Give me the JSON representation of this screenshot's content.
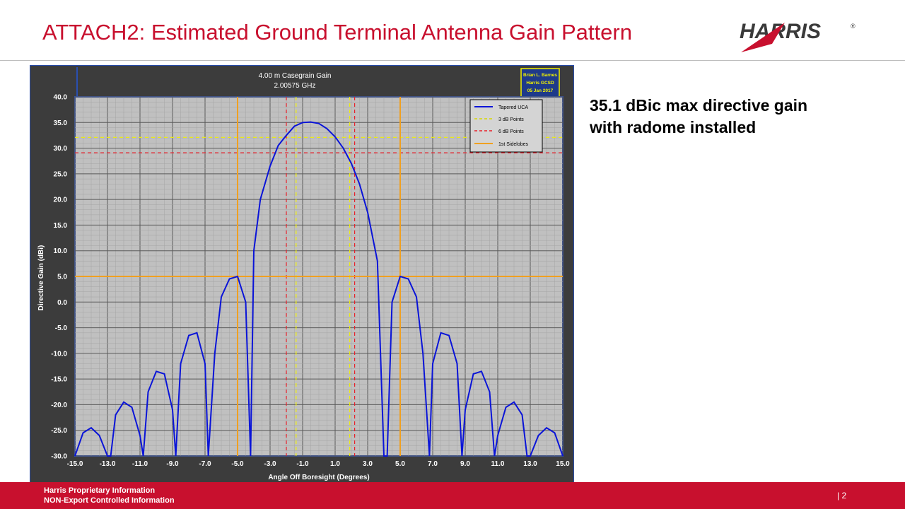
{
  "slide": {
    "title": "ATTACH2: Estimated Ground Terminal Antenna Gain Pattern",
    "callout_line1": "35.1 dBic max directive gain",
    "callout_line2": "with radome installed",
    "logo_text": "HARRIS",
    "logo_reg": "®",
    "footer_line1": "Harris Proprietary Information",
    "footer_line2": "NON-Export Controlled Information",
    "page_number": "| 2"
  },
  "colors": {
    "brand_red": "#c8102e",
    "plot_bg": "#c0c0c0",
    "frame_bg": "#3c3c3c",
    "series_blue": "#0a14d8",
    "three_db_yellow": "#f2f200",
    "six_db_red": "#e8202a",
    "sidelobe_orange": "#f0a020"
  },
  "chart_data": {
    "type": "line",
    "title": "4.00 m Casegrain Gain",
    "subtitle": "2.00575 GHz",
    "author_box": [
      "Brian L. Barnes",
      "Harris GCSD",
      "05 Jan 2017"
    ],
    "xlabel": "Angle Off Boresight (Degrees)",
    "ylabel": "Directive Gain (dBi)",
    "xlim": [
      -15,
      15
    ],
    "ylim": [
      -30,
      40
    ],
    "x_tick_labels": [
      "-15.0",
      "-13.0",
      "-11.0",
      "-9.0",
      "-7.0",
      "-5.0",
      "-3.0",
      "-1.0",
      "1.0",
      "3.0",
      "5.0",
      "7.0",
      "9.0",
      "11.0",
      "13.0",
      "15.0"
    ],
    "y_tick_labels": [
      "-30.0",
      "-25.0",
      "-20.0",
      "-15.0",
      "-10.0",
      "-5.0",
      "0.0",
      "5.0",
      "10.0",
      "15.0",
      "20.0",
      "25.0",
      "30.0",
      "35.0",
      "40.0"
    ],
    "grid": true,
    "legend_position": "top-right",
    "series": [
      {
        "name": "Tapered UCA",
        "style": "solid",
        "x": [
          -15,
          -14.5,
          -14.0,
          -13.5,
          -13.0,
          -12.8,
          -12.5,
          -12.0,
          -11.5,
          -11.0,
          -10.8,
          -10.5,
          -10.0,
          -9.5,
          -9.0,
          -8.8,
          -8.5,
          -8.0,
          -7.5,
          -7.0,
          -6.8,
          -6.4,
          -6.0,
          -5.5,
          -5.0,
          -4.5,
          -4.2,
          -4.0,
          -3.6,
          -3.0,
          -2.5,
          -2.0,
          -1.5,
          -1.0,
          -0.5,
          0.0,
          0.5,
          1.0,
          1.5,
          2.0,
          2.5,
          3.0,
          3.6,
          4.0,
          4.2,
          4.5,
          5.0,
          5.5,
          6.0,
          6.4,
          6.8,
          7.0,
          7.5,
          8.0,
          8.5,
          8.8,
          9.0,
          9.5,
          10.0,
          10.5,
          10.8,
          11.0,
          11.5,
          12.0,
          12.5,
          12.8,
          13.0,
          13.5,
          14.0,
          14.5,
          15.0
        ],
        "y": [
          -30.0,
          -25.5,
          -24.5,
          -26.0,
          -30.0,
          -30.0,
          -22.0,
          -19.5,
          -20.5,
          -26.0,
          -30.0,
          -17.5,
          -13.5,
          -14.0,
          -21.0,
          -30.0,
          -12.0,
          -6.5,
          -6.0,
          -12.0,
          -30.0,
          -10.0,
          1.0,
          4.5,
          5.0,
          0.0,
          -30.0,
          10.0,
          20.0,
          26.5,
          30.5,
          32.5,
          34.3,
          35.0,
          35.1,
          34.8,
          33.8,
          32.2,
          30.0,
          27.0,
          23.0,
          17.5,
          8.0,
          -30.0,
          -30.0,
          0.0,
          5.0,
          4.5,
          1.0,
          -10.0,
          -30.0,
          -12.0,
          -6.0,
          -6.5,
          -12.0,
          -30.0,
          -21.0,
          -14.0,
          -13.5,
          -17.5,
          -30.0,
          -26.0,
          -20.5,
          -19.5,
          -22.0,
          -30.0,
          -30.0,
          -26.0,
          -24.5,
          -25.5,
          -30.0
        ]
      },
      {
        "name": "3 dB Points",
        "style": "dashed",
        "vertical_x": [
          -1.4,
          1.9
        ],
        "horizontal_y": 32.1
      },
      {
        "name": "6 dB Points",
        "style": "dashed",
        "vertical_x": [
          -2.0,
          2.2
        ],
        "horizontal_y": 29.1
      },
      {
        "name": "1st Sidelobes",
        "style": "solid",
        "vertical_x": [
          -5.0,
          5.0
        ],
        "horizontal_y": 5.0
      }
    ]
  }
}
